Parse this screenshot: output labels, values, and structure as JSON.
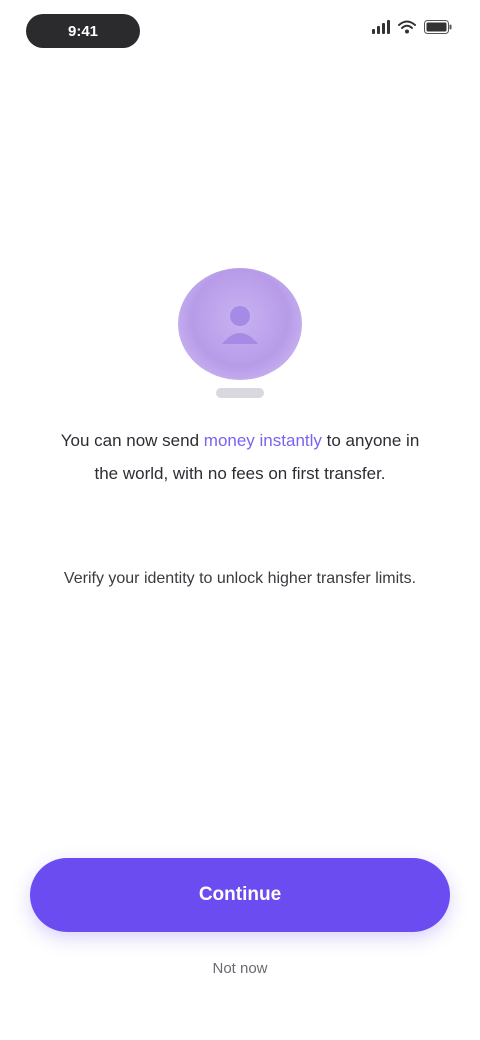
{
  "status_bar": {
    "time": "9:41"
  },
  "message": {
    "text_before": "You can now send",
    "text_highlight": "money instantly",
    "text_after": "to anyone in the world, with no fees on first transfer.",
    "secondary": "Verify your identity to unlock higher transfer limits."
  },
  "actions": {
    "primary_label": "Continue",
    "secondary_label": "Not now"
  },
  "colors": {
    "accent": "#6a4cf0",
    "highlight_text": "#7b62f0",
    "avatar": "#b79be9"
  },
  "icons": {
    "avatar": "user-icon",
    "signal": "signal-icon",
    "wifi": "wifi-icon",
    "battery": "battery-icon"
  }
}
